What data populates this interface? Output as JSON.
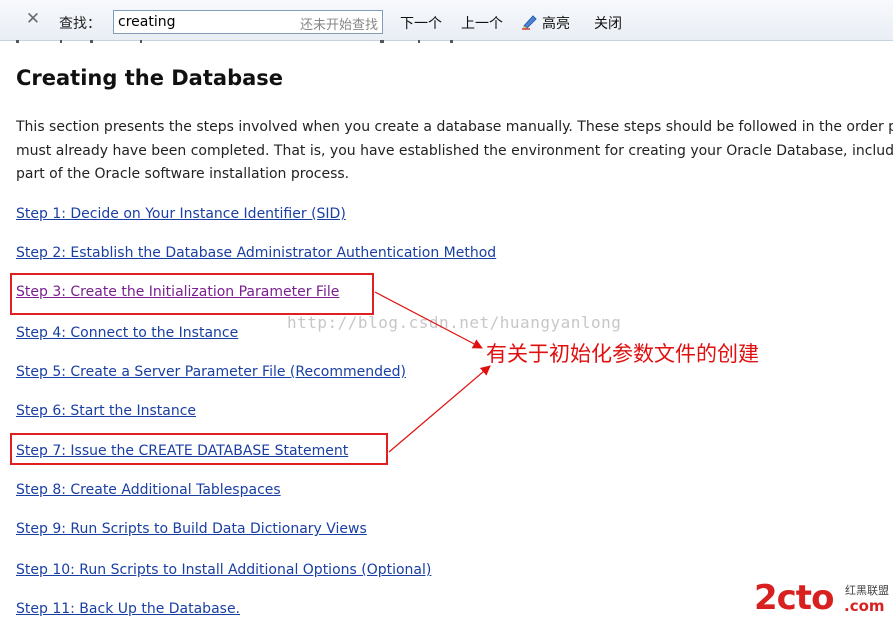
{
  "findbar": {
    "label": "查找：",
    "query": "creating",
    "status": "还未开始查找",
    "next_label": "下一个",
    "prev_label": "上一个",
    "highlight_label": "高亮",
    "close_label": "关闭"
  },
  "page": {
    "title": "Creating the Database",
    "paragraph_lines": [
      "This section presents the steps involved when you create a database manually. These steps should be followed in the order prese",
      "must already have been completed. That is, you have established the environment for creating your Oracle Database, including m",
      "part of the Oracle software installation process."
    ],
    "steps": [
      "Step 1: Decide on Your Instance Identifier (SID)",
      "Step 2: Establish the Database Administrator Authentication Method",
      "Step 3: Create the Initialization Parameter File",
      "Step 4: Connect to the Instance",
      "Step 5: Create a Server Parameter File (Recommended)",
      "Step 6: Start the Instance",
      "Step 7: Issue the CREATE DATABASE Statement",
      "Step 8: Create Additional Tablespaces",
      "Step 9: Run Scripts to Build Data Dictionary Views",
      "Step 10: Run Scripts to Install Additional Options (Optional)",
      "Step 11: Back Up the Database."
    ]
  },
  "overlay": {
    "watermark": "http://blog.csdn.net/huangyanlong",
    "annotation": "有关于初始化参数文件的创建",
    "logo_main": "2cto",
    "logo_cn": "红黑联盟",
    "logo_com": ".com"
  },
  "colors": {
    "link": "#1a3fa3",
    "visited_link": "#7a1f8f",
    "annotation_red": "#e01010"
  }
}
